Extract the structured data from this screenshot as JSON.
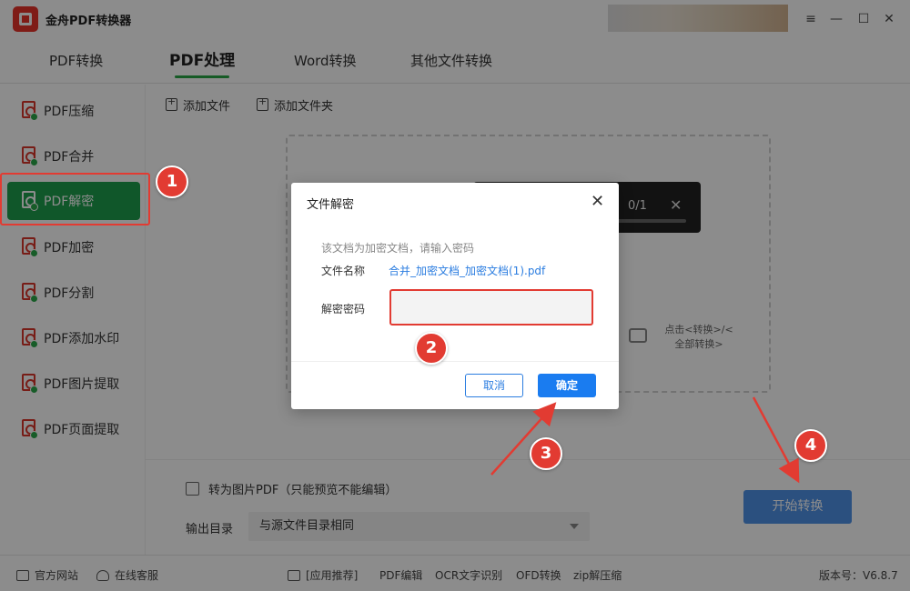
{
  "app": {
    "title": "金舟PDF转换器"
  },
  "tabs": [
    {
      "label": "PDF转换"
    },
    {
      "label": "PDF处理"
    },
    {
      "label": "Word转换"
    },
    {
      "label": "其他文件转换"
    }
  ],
  "sidebar": {
    "items": [
      {
        "label": "PDF压缩"
      },
      {
        "label": "PDF合并"
      },
      {
        "label": "PDF解密"
      },
      {
        "label": "PDF加密"
      },
      {
        "label": "PDF分割"
      },
      {
        "label": "PDF添加水印"
      },
      {
        "label": "PDF图片提取"
      },
      {
        "label": "PDF页面提取"
      }
    ],
    "active_index": 2
  },
  "toolbar": {
    "add_file": "添加文件",
    "add_folder": "添加文件夹"
  },
  "progress": {
    "count": "0/1",
    "fraction": 0.0
  },
  "convert_hint": "点击<转换>/<全部转换>",
  "options": {
    "image_pdf_label": "转为图片PDF（只能预览不能编辑）",
    "output_dir_label": "输出目录",
    "output_dir_value": "与源文件目录相同"
  },
  "start_button": "开始转换",
  "statusbar": {
    "official_site": "官方网站",
    "online_service": "在线客服",
    "app_recommend": "[应用推荐]",
    "links": [
      "PDF编辑",
      "OCR文字识别",
      "OFD转换",
      "zip解压缩"
    ],
    "version": "版本号：V6.8.7"
  },
  "dialog": {
    "title": "文件解密",
    "hint": "该文档为加密文档，请输入密码",
    "filename_label": "文件名称",
    "filename": "合并_加密文档_加密文档(1).pdf",
    "password_label": "解密密码",
    "cancel": "取消",
    "ok": "确定"
  },
  "markers": [
    "1",
    "2",
    "3",
    "4"
  ],
  "colors": {
    "accent_green": "#1e9e4d",
    "primary_blue": "#1a7cf0",
    "annotation_red": "#e23b32"
  }
}
